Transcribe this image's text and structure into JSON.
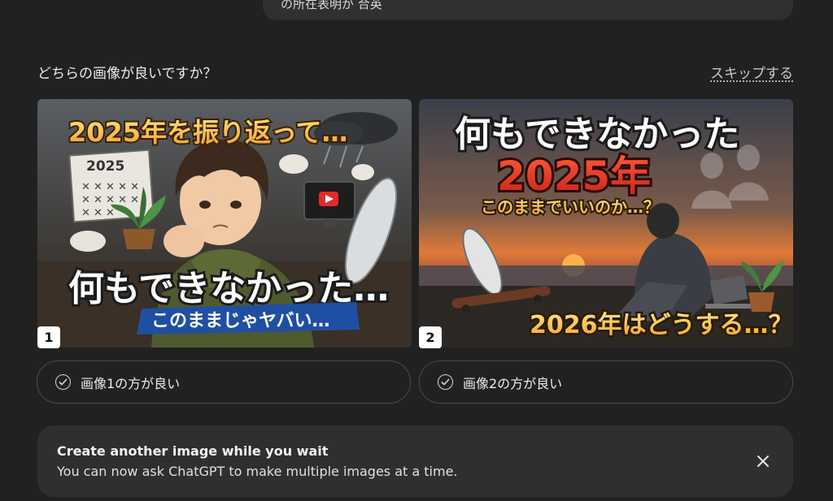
{
  "top_pill": {
    "text": "の所在表明が          合英"
  },
  "question": "どちらの画像が良いですか？",
  "skip_label": "スキップする",
  "cards": [
    {
      "badge": "1",
      "headline_top": "2025年を振り返って…",
      "calendar_year": "2025",
      "headline_main": "何もできなかった…",
      "banner": "このままじゃヤバい…",
      "choice_label": "画像1の方が良い"
    },
    {
      "badge": "2",
      "headline_top": "何もできなかった",
      "headline_year": "2025年",
      "subline": "このままでいいのか…？",
      "bottom_line": "2026年はどうする…？",
      "choice_label": "画像2の方が良い"
    }
  ],
  "toast": {
    "title": "Create another image while you wait",
    "body": "You can now ask ChatGPT to make multiple images at a time."
  },
  "colors": {
    "background": "#212121",
    "toast_bg": "#2f2f2f",
    "border": "#4a4a4a",
    "text": "#ececec",
    "accent_yellow": "#f5c542",
    "accent_red": "#d8352a"
  },
  "icons": {
    "check": "check-circle-icon",
    "close": "close-icon"
  }
}
